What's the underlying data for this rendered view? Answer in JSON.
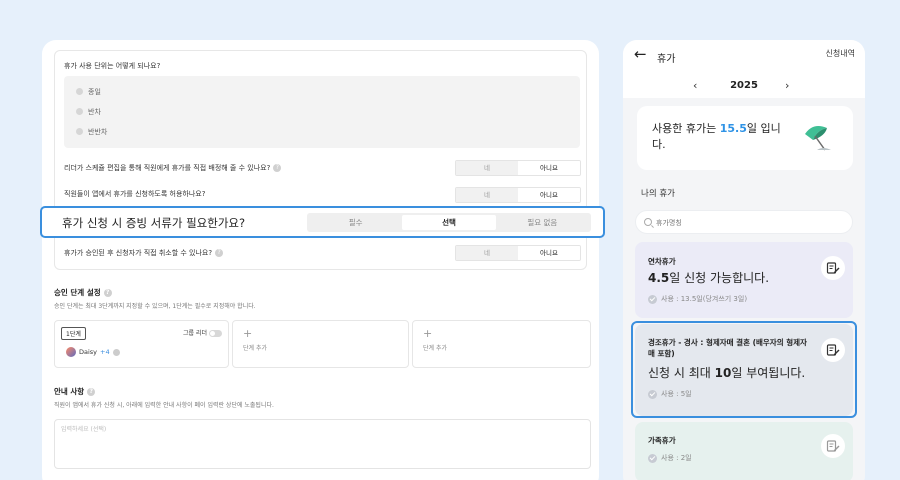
{
  "settings": {
    "q_unit": "휴가 사용 단위는 어떻게 되나요?",
    "unit_options": [
      "종일",
      "반차",
      "반반차"
    ],
    "q_leader_edit": "리더가 스케쥴 편집을 통해 직원에게 휴가를 직접 배정해 줄 수 있나요?",
    "q_app_apply": "직원들이 앱에서 휴가를 신청하도록 허용하나요?",
    "q_cancel": "휴가가 승인된 후 신청자가 직접 취소할 수 있나요?",
    "yes": "네",
    "no": "아니요",
    "q_document": "휴가 신청 시 증빙 서류가 필요한가요?",
    "doc_options": [
      "필수",
      "선택",
      "필요 없음"
    ],
    "approval_title": "승인 단계 설정",
    "approval_desc": "승인 단계는 최대 3단계까지 지정할 수 있으며, 1단계는 필수로 지정해야 합니다.",
    "stage1_tag": "1단계",
    "group_leader": "그룹 리더",
    "member_name": "Daisy",
    "member_more": "+4",
    "add_stage": "단계 추가",
    "guide_title": "안내 사항",
    "guide_desc": "직원이 앱에서 휴가 신청 시, 아래에 입력한 안내 사항이 폐이 입력란 상단에 노출됩니다.",
    "guide_placeholder": "입력하세요 (선택)",
    "help_glyph": "?"
  },
  "mobile": {
    "title": "휴가",
    "history_link": "신청내역",
    "year": "2025",
    "prev_glyph": "‹",
    "next_glyph": "›",
    "back_glyph": "←",
    "used_prefix": "사용한 휴가는 ",
    "used_days": "15.5",
    "used_suffix": "일 입니다.",
    "my_leave": "나의 휴가",
    "search_placeholder": "휴가명칭",
    "cards": [
      {
        "name": "연차휴가",
        "main_num": "4.5",
        "main_text": "일 신청 가능합니다.",
        "sub": "사용 : 13.5일(당겨쓰기 3일)"
      },
      {
        "name": "경조휴가 - 경사 : 형제자매 결혼 (배우자의 형제자매 포함)",
        "main_prefix": "신청 시 최대 ",
        "main_num": "10",
        "main_text": "일 부여됩니다.",
        "sub": "사용 : 5일"
      },
      {
        "name": "가족휴가",
        "sub": "사용 : 2일"
      }
    ]
  },
  "colors": {
    "accent": "#3a8fde",
    "highlight_num": "#2f93e6",
    "card1_bg": "#ebebf7",
    "card2_bg": "#e4e8ee",
    "card3_bg": "#e6f1ee"
  }
}
